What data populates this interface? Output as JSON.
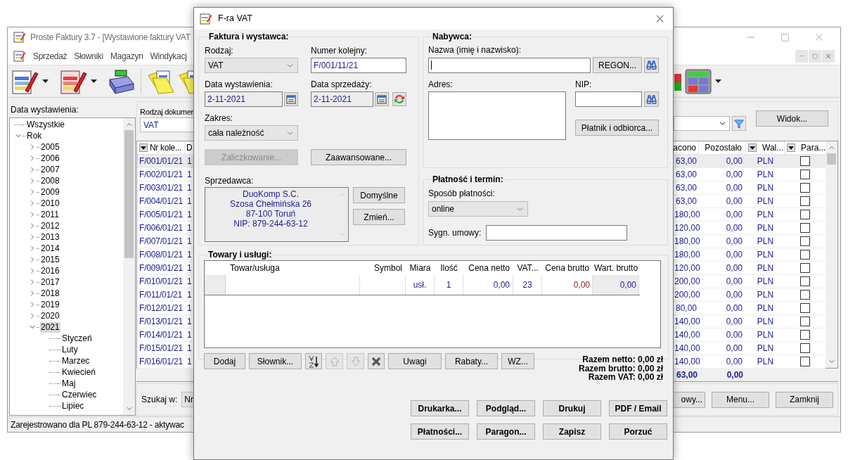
{
  "main_window": {
    "title": "Proste Faktury 3.7 - [Wystawione faktury VAT",
    "menu": [
      "Sprzedaż",
      "Słowniki",
      "Magazyn",
      "Windykacj"
    ],
    "date_panel": {
      "label": "Data wystawienia:",
      "tree": [
        {
          "label": "Wszystkie",
          "selected": false
        },
        {
          "label": "Rok",
          "selected": false,
          "expanded": true,
          "children": [
            {
              "label": "2005",
              "selected": false,
              "expanded": false
            },
            {
              "label": "2006",
              "selected": false,
              "expanded": false
            },
            {
              "label": "2007",
              "selected": false,
              "expanded": false
            },
            {
              "label": "2008",
              "selected": false,
              "expanded": false
            },
            {
              "label": "2009",
              "selected": false,
              "expanded": false
            },
            {
              "label": "2010",
              "selected": false,
              "expanded": false
            },
            {
              "label": "2011",
              "selected": false,
              "expanded": false
            },
            {
              "label": "2012",
              "selected": false,
              "expanded": false
            },
            {
              "label": "2013",
              "selected": false,
              "expanded": false
            },
            {
              "label": "2014",
              "selected": false,
              "expanded": false
            },
            {
              "label": "2015",
              "selected": false,
              "expanded": false
            },
            {
              "label": "2016",
              "selected": false,
              "expanded": false
            },
            {
              "label": "2017",
              "selected": false,
              "expanded": false
            },
            {
              "label": "2018",
              "selected": false,
              "expanded": false
            },
            {
              "label": "2019",
              "selected": false,
              "expanded": false
            },
            {
              "label": "2020",
              "selected": false,
              "expanded": false
            },
            {
              "label": "2021",
              "selected": true,
              "expanded": true,
              "children": [
                {
                  "label": "Styczeń",
                  "selected": false
                },
                {
                  "label": "Luty",
                  "selected": false
                },
                {
                  "label": "Marzec",
                  "selected": false
                },
                {
                  "label": "Kwiecień",
                  "selected": false
                },
                {
                  "label": "Maj",
                  "selected": false
                },
                {
                  "label": "Czerwiec",
                  "selected": false
                },
                {
                  "label": "Lipiec",
                  "selected": false
                }
              ]
            }
          ]
        }
      ]
    },
    "doc_type": {
      "label": "Rodzaj dokumen",
      "value": "VAT"
    },
    "view_button": "Widok...",
    "table": {
      "columns": {
        "number": "Nr kole...",
        "column_2": "D",
        "column_3": "acono",
        "remaining": "Pozostało",
        "currency": "Wal...",
        "para": "Para..."
      },
      "rows": [
        {
          "selected": true,
          "number": "F/001/01/21",
          "column_2": "1",
          "column_3": "63,00",
          "remaining": "0,00",
          "currency": "PLN",
          "checked": false
        },
        {
          "selected": false,
          "number": "F/002/01/21",
          "column_2": "1",
          "column_3": "63,00",
          "remaining": "0,00",
          "currency": "PLN",
          "checked": false
        },
        {
          "selected": false,
          "number": "F/003/01/21",
          "column_2": "1",
          "column_3": "63,00",
          "remaining": "0,00",
          "currency": "PLN",
          "checked": false
        },
        {
          "selected": false,
          "number": "F/004/01/21",
          "column_2": "1",
          "column_3": "63,00",
          "remaining": "0,00",
          "currency": "PLN",
          "checked": false
        },
        {
          "selected": false,
          "number": "F/005/01/21",
          "column_2": "1",
          "column_3": "180,00",
          "remaining": "0,00",
          "currency": "PLN",
          "checked": false
        },
        {
          "selected": false,
          "number": "F/006/01/21",
          "column_2": "1",
          "column_3": "120,00",
          "remaining": "0,00",
          "currency": "PLN",
          "checked": false
        },
        {
          "selected": false,
          "number": "F/007/01/21",
          "column_2": "1",
          "column_3": "180,00",
          "remaining": "0,00",
          "currency": "PLN",
          "checked": false
        },
        {
          "selected": false,
          "number": "F/008/01/21",
          "column_2": "1",
          "column_3": "180,00",
          "remaining": "0,00",
          "currency": "PLN",
          "checked": false
        },
        {
          "selected": false,
          "number": "F/009/01/21",
          "column_2": "1",
          "column_3": "120,00",
          "remaining": "0,00",
          "currency": "PLN",
          "checked": false
        },
        {
          "selected": false,
          "number": "F/010/01/21",
          "column_2": "1",
          "column_3": "200,00",
          "remaining": "0,00",
          "currency": "PLN",
          "checked": false
        },
        {
          "selected": false,
          "number": "F/011/01/21",
          "column_2": "1",
          "column_3": "200,00",
          "remaining": "0,00",
          "currency": "PLN",
          "checked": false
        },
        {
          "selected": false,
          "number": "F/012/01/21",
          "column_2": "1",
          "column_3": "80,00",
          "remaining": "0,00",
          "currency": "PLN",
          "checked": false
        },
        {
          "selected": false,
          "number": "F/013/01/21",
          "column_2": "1",
          "column_3": "140,00",
          "remaining": "0,00",
          "currency": "PLN",
          "checked": false
        },
        {
          "selected": false,
          "number": "F/014/01/21",
          "column_2": "1",
          "column_3": "140,00",
          "remaining": "0,00",
          "currency": "PLN",
          "checked": false
        },
        {
          "selected": false,
          "number": "F/015/01/21",
          "column_2": "1",
          "column_3": "140,00",
          "remaining": "0,00",
          "currency": "PLN",
          "checked": false
        },
        {
          "selected": false,
          "number": "F/016/01/21",
          "column_2": "1",
          "column_3": "140,00",
          "remaining": "0,00",
          "currency": "PLN",
          "checked": false
        }
      ],
      "totals": {
        "column_3": "63,00",
        "remaining": "0,00"
      }
    },
    "search": {
      "label": "Szukaj w:",
      "value": "Nr"
    },
    "buttons": [
      "owy...",
      "Menu...",
      "Zamknij"
    ],
    "status_bar": "Zarejestrowano dla PL 879-244-63-12 - aktywac"
  },
  "dialog": {
    "title": "F-ra VAT",
    "invoice_group": {
      "title": "Faktura i wystawca:",
      "type": {
        "label": "Rodzaj:",
        "value": "VAT"
      },
      "number": {
        "label": "Numer kolejny:",
        "value": "F/001/11/21"
      },
      "issue_date": {
        "label": "Data wystawienia:",
        "value": "2-11-2021"
      },
      "sale_date": {
        "label": "Data sprzedaży:",
        "value": "2-11-2021"
      },
      "scope": {
        "label": "Zakres:",
        "value": "cała należność"
      },
      "advance_button": {
        "label": "Zaliczkowanie...",
        "disabled": true
      },
      "advanced_button": {
        "label": "Zaawansowane...",
        "disabled": false
      },
      "seller": {
        "label": "Sprzedawca:",
        "lines": [
          "DuoKomp S.C.",
          "Szosa Chełmińska 26",
          "87-100 Toruń",
          "NIP: 879-244-63-12"
        ]
      },
      "default_button": "Domyślne",
      "change_button": "Zmień..."
    },
    "buyer_group": {
      "title": "Nabywca:",
      "name_label": "Nazwa (imię i nazwisko):",
      "regon_button": "REGON...",
      "address_label": "Adres:",
      "nip_label": "NIP:",
      "payer_button": "Płatnik i odbiorca..."
    },
    "payment_group": {
      "title": "Płatność i termin:",
      "method": {
        "label": "Sposób płatności:",
        "value": "online"
      },
      "contract_label": "Sygn. umowy:"
    },
    "items_group": {
      "title": "Towary i usługi:",
      "columns": [
        "Towar/usługa",
        "Symbol",
        "Miara",
        "Ilość",
        "Cena netto",
        "VAT...",
        "Cena brutto",
        "Wart. brutto"
      ],
      "rows": [
        {
          "unit": "usł.",
          "quantity": "1",
          "net_price": "0,00",
          "vat": "23",
          "gross_price": "0,00",
          "gross_value": "0,00"
        }
      ],
      "buttons": [
        {
          "kind": "text",
          "label": "Dodaj",
          "disabled": false
        },
        {
          "kind": "text",
          "label": "Słownik...",
          "disabled": false
        },
        {
          "kind": "sort",
          "disabled": false
        },
        {
          "kind": "up",
          "disabled": true
        },
        {
          "kind": "down",
          "disabled": true
        },
        {
          "kind": "delete",
          "disabled": false
        },
        {
          "kind": "text",
          "label": "Uwagi",
          "disabled": false
        },
        {
          "kind": "text",
          "label": "Rabaty...",
          "disabled": false
        },
        {
          "kind": "text",
          "label": "WZ...",
          "disabled": false
        }
      ],
      "totals": [
        "Razem netto: 0,00 zł",
        "Razem brutto: 0,00 zł",
        "Razem VAT: 0,00 zł"
      ]
    },
    "actions": [
      "Drukarka...",
      "Podgląd...",
      "Drukuj",
      "PDF / Email",
      "Płatności...",
      "Paragon...",
      "Zapisz",
      "Porzuć"
    ]
  }
}
